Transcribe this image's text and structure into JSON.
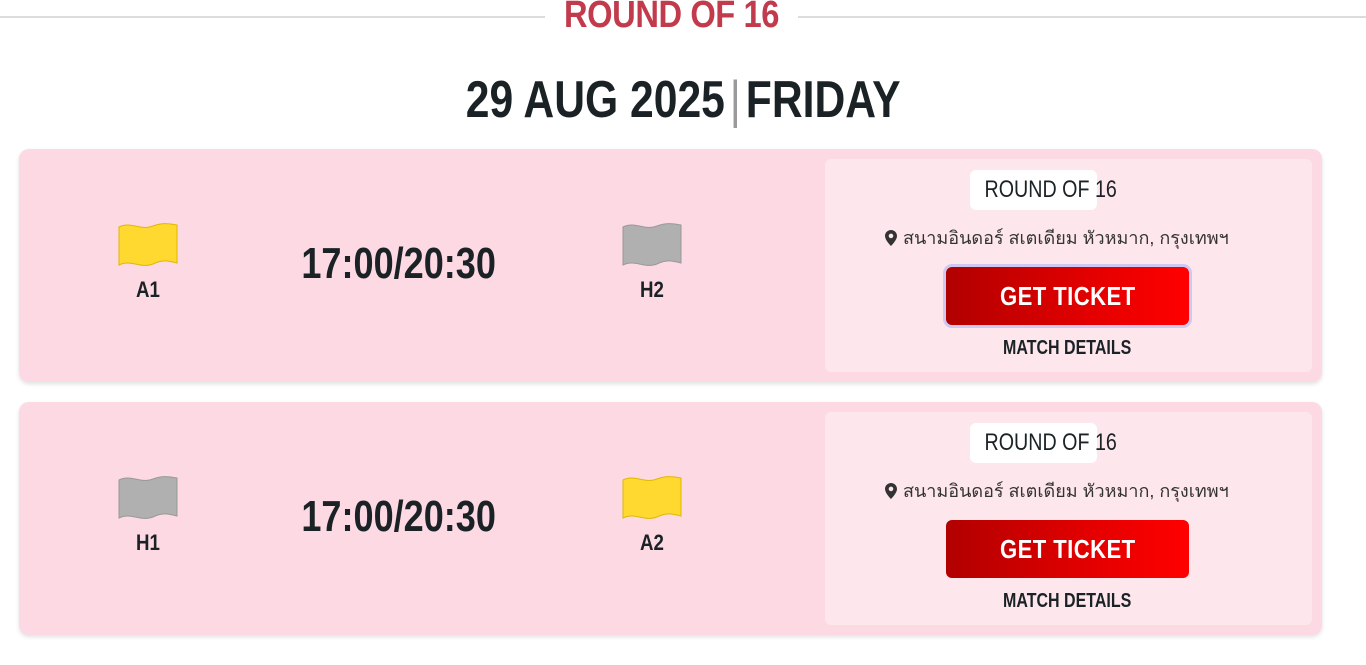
{
  "header": {
    "section_title": "ROUND OF 16",
    "date": "29 AUG 2025",
    "separator": "|",
    "weekday": "FRIDAY"
  },
  "colors": {
    "accent_red": "#c23b4c",
    "card_bg": "#fdd9e3",
    "flag_yellow": "#ffd92f",
    "flag_grey": "#b0b0b0"
  },
  "matches": [
    {
      "home": {
        "label": "A1",
        "flag": "yellow-flag-icon"
      },
      "away": {
        "label": "H2",
        "flag": "grey-flag-icon"
      },
      "time": "17:00/20:30",
      "round": "ROUND OF 16",
      "venue": "สนามอินดอร์ สเตเดียม หัวหมาก, กรุงเทพฯ",
      "ticket_label": "GET TICKET",
      "details_label": "MATCH DETAILS"
    },
    {
      "home": {
        "label": "H1",
        "flag": "grey-flag-icon"
      },
      "away": {
        "label": "A2",
        "flag": "yellow-flag-icon"
      },
      "time": "17:00/20:30",
      "round": "ROUND OF 16",
      "venue": "สนามอินดอร์ สเตเดียม หัวหมาก, กรุงเทพฯ",
      "ticket_label": "GET TICKET",
      "details_label": "MATCH DETAILS"
    }
  ]
}
